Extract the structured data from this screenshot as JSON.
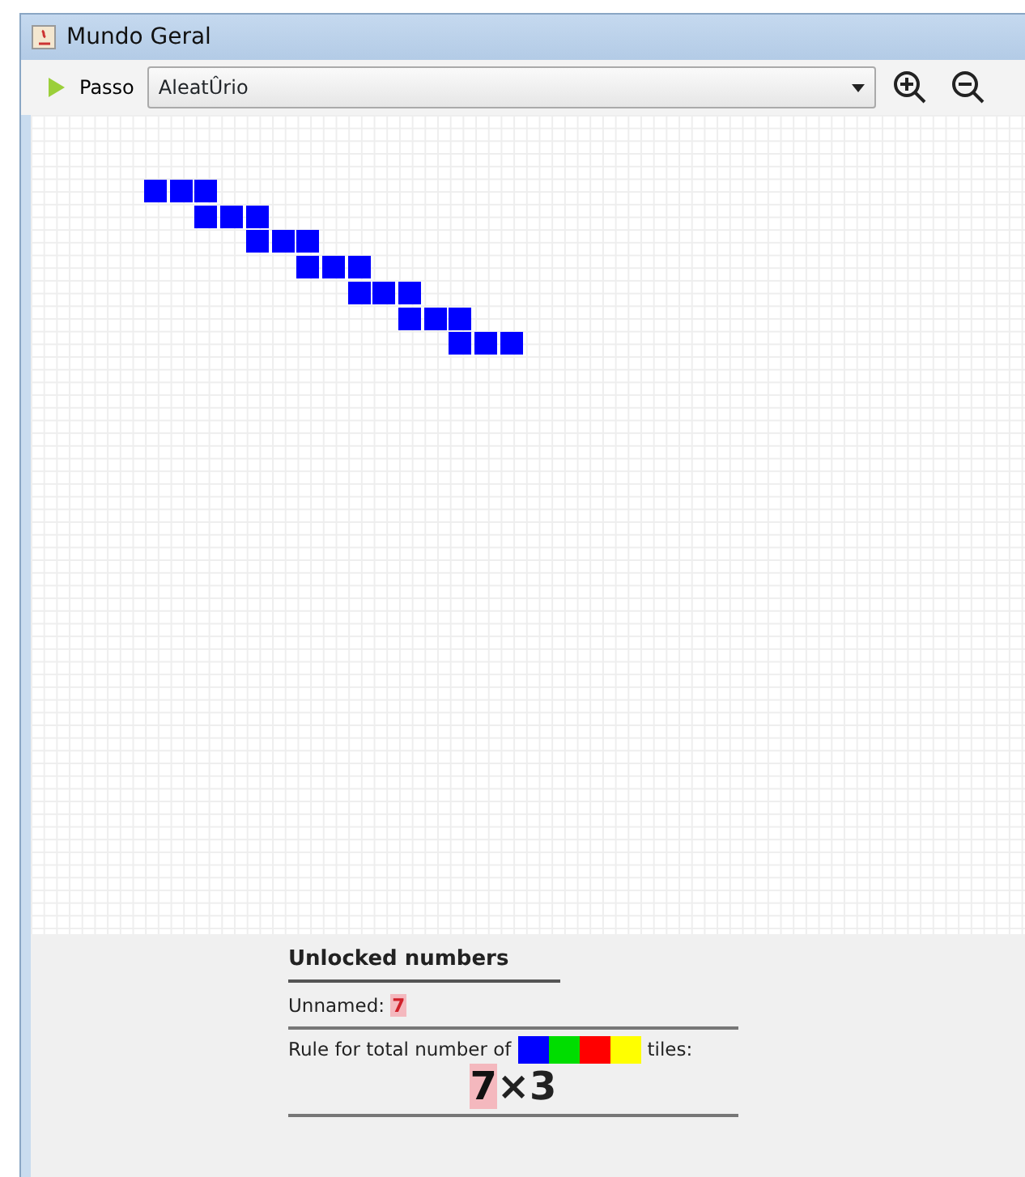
{
  "window": {
    "title": "Mundo Geral"
  },
  "toolbar": {
    "step_button": "Passo",
    "mode_select": {
      "value": "AleatÛrio"
    }
  },
  "tile_steps": [
    {
      "tiles": [
        {
          "color": "#0000ff"
        },
        {
          "color": "#0000ff"
        },
        {
          "color": "#0000ff"
        }
      ]
    },
    {
      "tiles": [
        {
          "color": "#0000ff"
        },
        {
          "color": "#0000ff"
        },
        {
          "color": "#0000ff"
        }
      ]
    },
    {
      "tiles": [
        {
          "color": "#0000ff"
        },
        {
          "color": "#0000ff"
        },
        {
          "color": "#0000ff"
        }
      ]
    },
    {
      "tiles": [
        {
          "color": "#0000ff"
        },
        {
          "color": "#0000ff"
        },
        {
          "color": "#0000ff"
        }
      ]
    },
    {
      "tiles": [
        {
          "color": "#0000ff"
        },
        {
          "color": "#0000ff"
        },
        {
          "color": "#0000ff"
        }
      ]
    },
    {
      "tiles": [
        {
          "color": "#0000ff"
        },
        {
          "color": "#0000ff"
        },
        {
          "color": "#0000ff"
        }
      ]
    },
    {
      "tiles": [
        {
          "color": "#0000ff"
        },
        {
          "color": "#0000ff"
        },
        {
          "color": "#0000ff"
        }
      ]
    }
  ],
  "panel": {
    "heading": "Unlocked numbers",
    "unnamed_label": "Unnamed:",
    "unnamed_value": "7",
    "rule_text": "Rule for total number of",
    "rule_colors": [
      {
        "color": "#0000ff"
      },
      {
        "color": "#00dd00"
      },
      {
        "color": "#ff0000"
      },
      {
        "color": "#ffff00"
      }
    ],
    "rule_suffix": "tiles:",
    "rule_count": "7",
    "rule_factor": "×3"
  }
}
